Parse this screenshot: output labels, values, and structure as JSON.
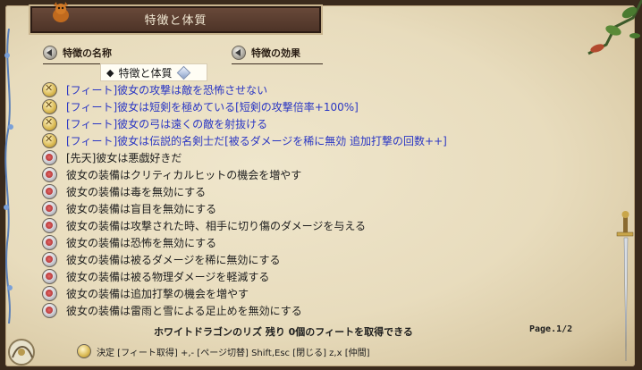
{
  "window": {
    "title": "特徴と体質"
  },
  "columns": {
    "name_header": "特徴の名称",
    "effect_header": "特徴の効果"
  },
  "category": {
    "marker": "◆",
    "label": "特徴と体質"
  },
  "items": [
    {
      "type": "feat",
      "text": "[フィート]彼女の攻撃は敵を恐怖させない",
      "color": "#2a36c4"
    },
    {
      "type": "feat",
      "text": "[フィート]彼女は短剣を極めている[短剣の攻撃倍率+100%]",
      "color": "#2a36c4"
    },
    {
      "type": "feat",
      "text": "[フィート]彼女の弓は遠くの敵を射抜ける",
      "color": "#2a36c4"
    },
    {
      "type": "feat",
      "text": "[フィート]彼女は伝説的名剣士だ[被るダメージを稀に無効 追加打撃の回数++]",
      "color": "#2a36c4"
    },
    {
      "type": "trait",
      "text": "[先天]彼女は悪戯好きだ",
      "color": "#1e1e1e"
    },
    {
      "type": "trait",
      "text": "彼女の装備はクリティカルヒットの機会を増やす",
      "color": "#1e1e1e"
    },
    {
      "type": "trait",
      "text": "彼女の装備は毒を無効にする",
      "color": "#1e1e1e"
    },
    {
      "type": "trait",
      "text": "彼女の装備は盲目を無効にする",
      "color": "#1e1e1e"
    },
    {
      "type": "trait",
      "text": "彼女の装備は攻撃された時、相手に切り傷のダメージを与える",
      "color": "#1e1e1e"
    },
    {
      "type": "trait",
      "text": "彼女の装備は恐怖を無効にする",
      "color": "#1e1e1e"
    },
    {
      "type": "trait",
      "text": "彼女の装備は被るダメージを稀に無効にする",
      "color": "#1e1e1e"
    },
    {
      "type": "trait",
      "text": "彼女の装備は被る物理ダメージを軽減する",
      "color": "#1e1e1e"
    },
    {
      "type": "trait",
      "text": "彼女の装備は追加打撃の機会を増やす",
      "color": "#1e1e1e"
    },
    {
      "type": "trait",
      "text": "彼女の装備は雷雨と雪による足止めを無効にする",
      "color": "#1e1e1e"
    }
  ],
  "status": {
    "remaining": "ホワイトドラゴンのリズ 残り 0個のフィートを取得できる",
    "page": "Page.1/2"
  },
  "help": {
    "text": "決定 [フィート取得]  +,- [ページ切替]  Shift,Esc [閉じる]  z,x [仲間]"
  },
  "icons": {
    "feat": "feat-star-icon",
    "trait": "trait-orb-icon",
    "header": "arrow-left-icon",
    "category_gem": "gem-icon"
  }
}
